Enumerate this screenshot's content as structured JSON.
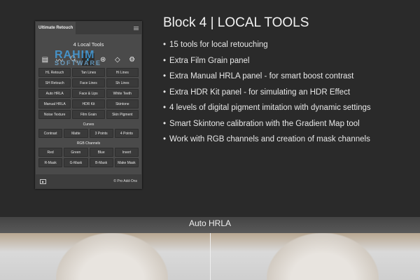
{
  "panel": {
    "title": "Ultimate Retouch",
    "heading": "4 Local Tools",
    "icons": [
      "document-icon",
      "heartbeat-icon",
      "magnifier-icon",
      "contrast-icon",
      "channels-icon",
      "diamond-icon",
      "gears-icon"
    ],
    "tools": [
      "HL Retouch",
      "Tan Lines",
      "Hi Lines",
      "SH Retouch",
      "Face Lines",
      "Sh Lines",
      "Auto HRLA",
      "Face & Lips",
      "White Teeth",
      "Manual HRLA",
      "HDR Kit",
      "Skintone",
      "Noise Texture",
      "Film Grain",
      "Skin Pigment"
    ],
    "curves_label": "Curves",
    "curves": [
      "Contrast",
      "Matte",
      "3 Points",
      "4 Points"
    ],
    "rgb_label": "RGB Channels",
    "rgb": [
      "Red",
      "Green",
      "Blue",
      "Invert",
      "R-Mask",
      "G-Mask",
      "B-Mask",
      "Make Mask"
    ],
    "footer": "© Pro Add-Ons"
  },
  "watermark": {
    "line1": "RAHIM",
    "line2": "SOFTWARE"
  },
  "main": {
    "title": "Block 4 | LOCAL TOOLS",
    "bullets": [
      "15 tools for local retouching",
      "Extra Film Grain panel",
      "Extra Manual HRLA panel - for smart boost contrast",
      "Extra HDR Kit panel - for simulating an HDR Effect",
      "4 levels of digital pigment imitation with dynamic settings",
      "Smart Skintone calibration with the Gradient Map tool",
      "Work with RGB channels and creation of mask channels"
    ]
  },
  "band": {
    "label": "Auto HRLA"
  },
  "accent": "#3ab4f2"
}
